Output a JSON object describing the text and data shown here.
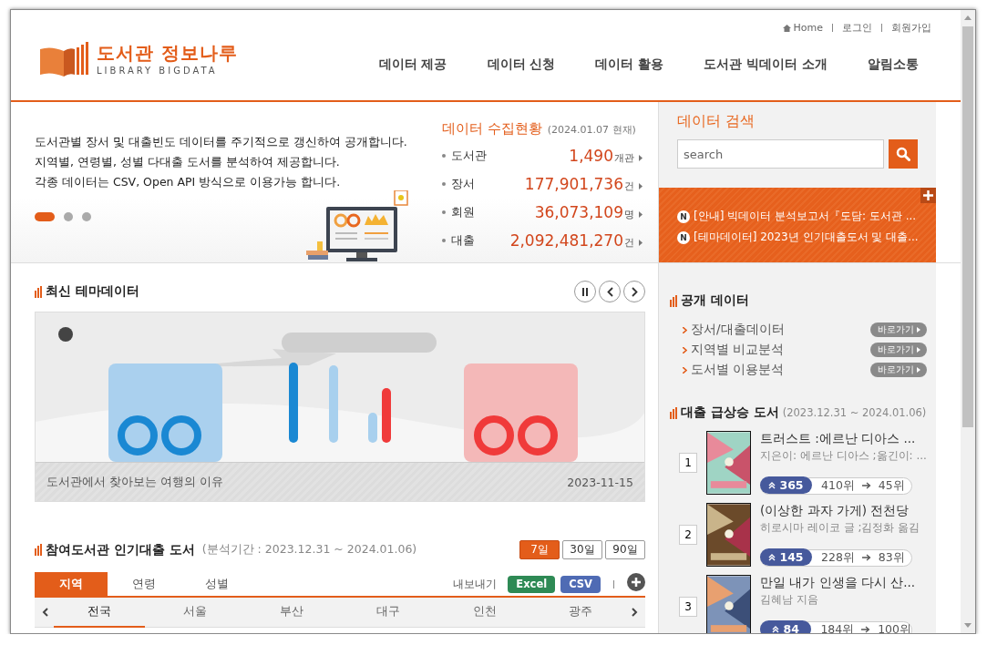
{
  "header": {
    "logo": {
      "title": "도서관 정보나루",
      "subtitle": "LIBRARY BIGDATA"
    },
    "top_links": [
      {
        "label": "Home",
        "kind": "home"
      },
      {
        "label": "로그인",
        "kind": "plain"
      },
      {
        "label": "회원가입",
        "kind": "plain"
      }
    ],
    "nav": [
      "데이터 제공",
      "데이터 신청",
      "데이터 활용",
      "도서관 빅데이터 소개",
      "알림소통"
    ]
  },
  "intro": {
    "lines": [
      "도서관별 장서 및 대출빈도 데이터를 주기적으로 갱신하여 공개합니다.",
      "지역별, 연령별, 성별 다대출 도서를 분석하여 제공합니다.",
      "각종 데이터는 CSV, Open API 방식으로 이용가능 합니다."
    ],
    "slides": [
      {
        "selected": true
      },
      {
        "selected": false
      },
      {
        "selected": false
      }
    ]
  },
  "stats": {
    "title": "데이터 수집현황",
    "date": "(2024.01.07 현재)",
    "rows": [
      {
        "label": "도서관",
        "value": "1,490",
        "unit": "개관"
      },
      {
        "label": "장서",
        "value": "177,901,736",
        "unit": "건"
      },
      {
        "label": "회원",
        "value": "36,073,109",
        "unit": "명"
      },
      {
        "label": "대출",
        "value": "2,092,481,270",
        "unit": "건"
      }
    ]
  },
  "search": {
    "title": "데이터 검색",
    "placeholder": "search"
  },
  "notices": [
    {
      "badge": "N",
      "text": "[안내] 빅데이터 분석보고서『도담: 도서관 ..."
    },
    {
      "badge": "N",
      "text": "[테마데이터] 2023년 인기대출도서 및 대출..."
    }
  ],
  "theme": {
    "title": "최신 테마데이터",
    "caption": "도서관에서 찾아보는 여행의 이유",
    "date": "2023-11-15"
  },
  "popular": {
    "title": "참여도서관 인기대출 도서",
    "period": "(분석기간 : 2023.12.31 ~ 2024.01.06)",
    "ranges": [
      {
        "label": "7일",
        "selected": true
      },
      {
        "label": "30일",
        "selected": false
      },
      {
        "label": "90일",
        "selected": false
      }
    ],
    "tabs": [
      {
        "label": "지역",
        "selected": true
      },
      {
        "label": "연령",
        "selected": false
      },
      {
        "label": "성별",
        "selected": false
      }
    ],
    "export_label": "내보내기",
    "exports": [
      {
        "label": "Excel",
        "color": "#2e8a55"
      },
      {
        "label": "CSV",
        "color": "#4f6bb4"
      }
    ],
    "regions": [
      {
        "label": "전국",
        "selected": true
      },
      {
        "label": "서울",
        "selected": false
      },
      {
        "label": "부산",
        "selected": false
      },
      {
        "label": "대구",
        "selected": false
      },
      {
        "label": "인천",
        "selected": false
      },
      {
        "label": "광주",
        "selected": false
      }
    ]
  },
  "open_data": {
    "title": "공개 데이터",
    "items": [
      {
        "label": "장서/대출데이터",
        "button": "바로가기"
      },
      {
        "label": "지역별 비교분석",
        "button": "바로가기"
      },
      {
        "label": "도서별 이용분석",
        "button": "바로가기"
      }
    ]
  },
  "rising": {
    "title": "대출 급상승 도서",
    "period": "(2023.12.31 ~ 2024.01.06)",
    "books": [
      {
        "rank": "1",
        "title": "트러스트 :에르난 디아스 ...",
        "author": "지은이: 에르난 디아스 ;옮긴이: ...",
        "rise": "365",
        "from": "410위",
        "to": "45위"
      },
      {
        "rank": "2",
        "title": "(이상한 과자 가게) 전천당",
        "author": "히로시마 레이코 글 ;김정화 옮김",
        "rise": "145",
        "from": "228위",
        "to": "83위"
      },
      {
        "rank": "3",
        "title": "만일 내가 인생을 다시 산...",
        "author": "김혜남 지음",
        "rise": "84",
        "from": "184위",
        "to": "100위"
      }
    ]
  }
}
